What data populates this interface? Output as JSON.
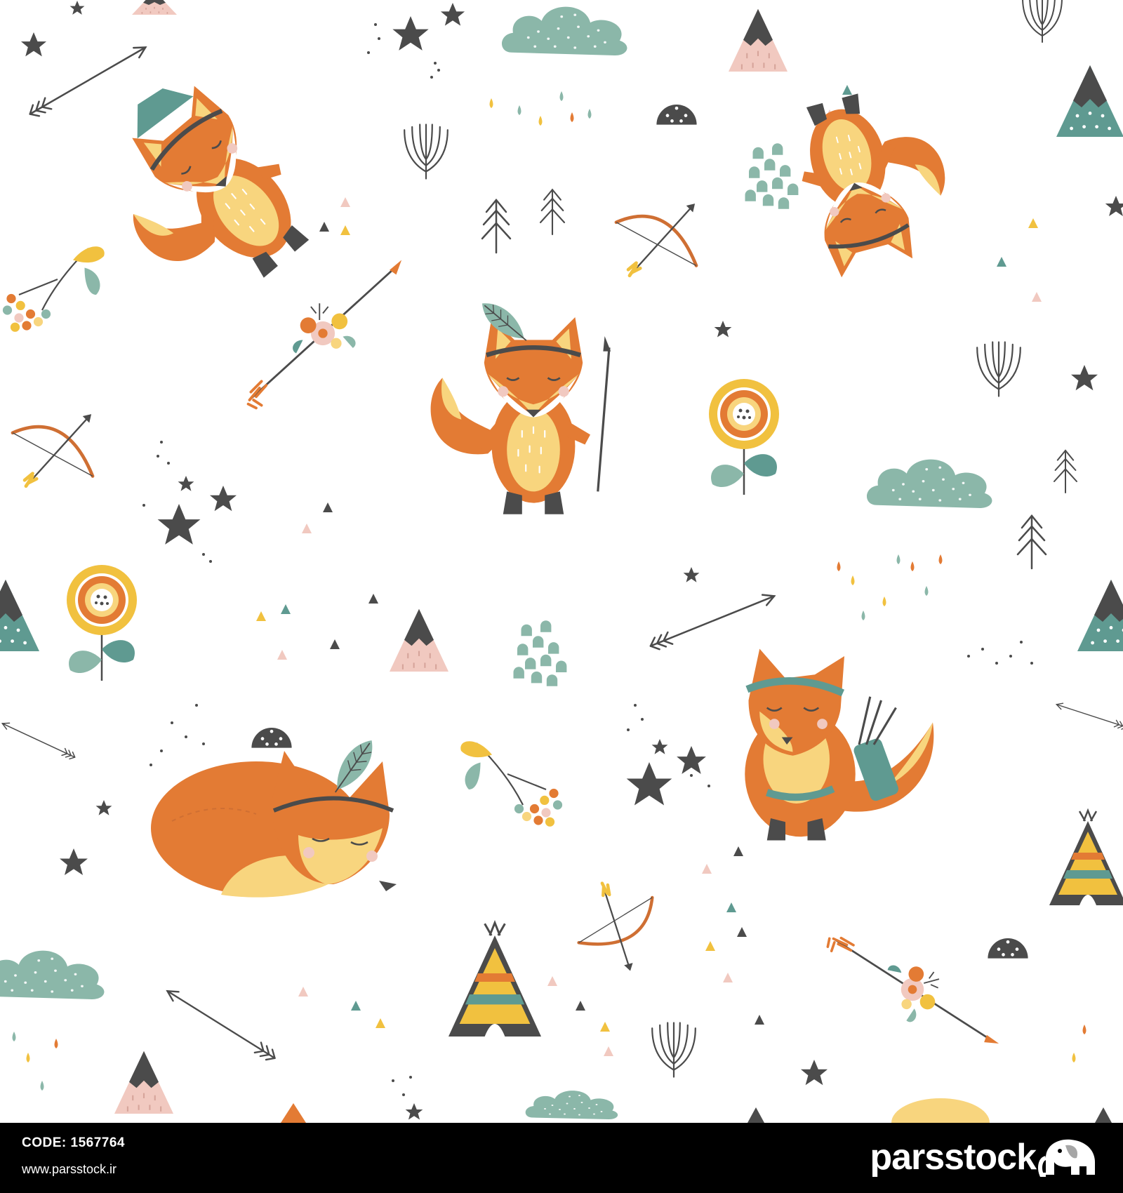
{
  "image": {
    "description_colors": {
      "fox": "#e37b34",
      "fox_light": "#f8d57e",
      "teal": "#8bb7a9",
      "dark": "#4b4b4b",
      "pink": "#f1c9c0",
      "yellow": "#f1c13f",
      "background": "#ffffff"
    },
    "watermark": "parsstock"
  },
  "footer": {
    "code_label": "CODE:",
    "code_value": "1567764",
    "url": "www.parsstock.ir",
    "brand": "parsstock",
    "brand_icon": "elephant-logo-icon"
  }
}
